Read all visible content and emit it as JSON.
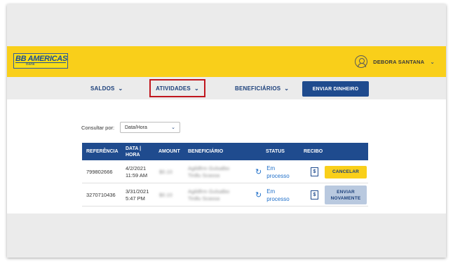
{
  "header": {
    "logo_main": "BB AMERICAS",
    "logo_sub": "Bank",
    "user_name": "DEBORA SANTANA"
  },
  "nav": {
    "items": [
      {
        "label": "SALDOS"
      },
      {
        "label": "ATIVIDADES"
      },
      {
        "label": "BENEFICIÁRIOS"
      }
    ],
    "send_button": "ENVIAR DINHEIRO"
  },
  "filter": {
    "label": "Consultar por:",
    "selected": "Data/Hora"
  },
  "table": {
    "headers": {
      "reference": "REFERÊNCIA",
      "date_line1": "DATA |",
      "date_line2": "HORA",
      "amount": "AMOUNT",
      "beneficiary": "BENEFICIÁRIO",
      "status": "STATUS",
      "receipt": "RECIBO"
    },
    "rows": [
      {
        "reference": "799802666",
        "date": "4/2/2021",
        "time": "11:59 AM",
        "amount": "$0.10",
        "beneficiary_line1": "Agildfrm Gulsalbo",
        "beneficiary_line2": "Tirdlu Scassa",
        "status_line1": "Em",
        "status_line2": "processo",
        "receipt_symbol": "$",
        "action": "CANCELAR"
      },
      {
        "reference": "3270710436",
        "date": "3/31/2021",
        "time": "5:47 PM",
        "amount": "$0.10",
        "beneficiary_line1": "Agildfrm Gulsalbo",
        "beneficiary_line2": "Tirdlu Scassa",
        "status_line1": "Em",
        "status_line2": "processo",
        "receipt_symbol": "$",
        "action_line1": "ENVIAR",
        "action_line2": "NOVAMENTE"
      }
    ]
  },
  "colors": {
    "brand_yellow": "#f9cf1a",
    "brand_blue": "#1f4b8e",
    "status_blue": "#1f6fc9",
    "highlight_red": "#c0161e"
  },
  "icons": {
    "user": "user-circle-icon",
    "chevron": "chevron-down-icon",
    "status": "sync-icon",
    "receipt": "receipt-icon"
  }
}
